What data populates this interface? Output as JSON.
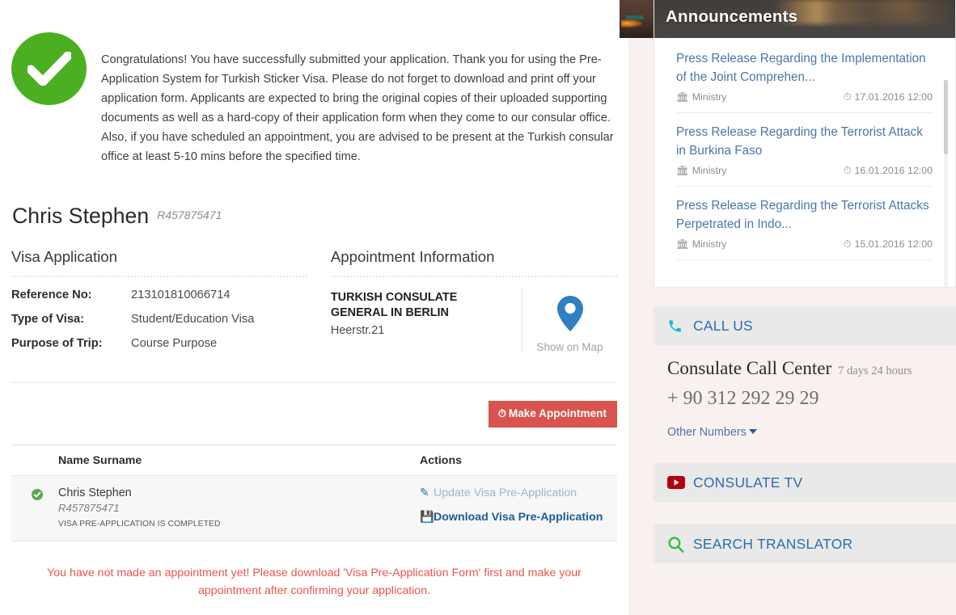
{
  "success": {
    "icon": "check-circle-icon",
    "message": "Congratulations! You have successfully submitted your application. Thank you for using the Pre-Application System for Turkish Sticker Visa. Please do not forget to download and print off your application form. Applicants are expected to bring the original copies of their uploaded supporting documents as well as a hard-copy of their application form when they come to our consular office. Also, if you have scheduled an appointment, you are advised to be present at the Turkish consular office at least 5-10 mins before the specified time."
  },
  "applicant": {
    "name": "Chris Stephen",
    "reference": "R457875471"
  },
  "visa_application": {
    "title": "Visa Application",
    "fields": [
      {
        "label": "Reference No:",
        "value": "213101810066714"
      },
      {
        "label": "Type of Visa:",
        "value": "Student/Education Visa"
      },
      {
        "label": "Purpose of Trip:",
        "value": "Course Purpose"
      }
    ]
  },
  "appointment": {
    "title": "Appointment Information",
    "office": "TURKISH CONSULATE GENERAL IN BERLIN",
    "address": "Heerstr.21",
    "map_label": "Show on Map",
    "map_icon": "map-pin-icon",
    "make_appointment_label": "Make Appointment",
    "make_appointment_icon": "clock-icon",
    "button_color": "#d9534f"
  },
  "table": {
    "columns": [
      "Name Surname",
      "Actions"
    ],
    "rows": [
      {
        "status_icon": "check-circle-small-icon",
        "name": "Chris Stephen",
        "reference": "R457875471",
        "status": "VISA PRE-APPLICATION IS COMPLETED",
        "actions": [
          {
            "label": "Update Visa Pre-Application",
            "icon": "pencil-icon",
            "emphasis": "normal"
          },
          {
            "label": "Download Visa Pre-Application",
            "icon": "floppy-disk-icon",
            "emphasis": "strong"
          }
        ]
      }
    ]
  },
  "warning": {
    "text": "You have not made an appointment yet! Please download 'Visa Pre-Application Form' first and make your appointment after confirming your application.",
    "color": "#ef5350"
  },
  "sidebar": {
    "announcements": {
      "title": "Announcements",
      "items": [
        {
          "title": "Press Release Regarding the Implementation of the Joint Comprehen...",
          "source": "Ministry",
          "source_icon": "institution-icon",
          "date": "17.01.2016 12:00",
          "date_icon": "clock-icon"
        },
        {
          "title": "Press Release Regarding the Terrorist Attack in Burkina Faso",
          "source": "Ministry",
          "source_icon": "institution-icon",
          "date": "16.01.2016 12:00",
          "date_icon": "clock-icon"
        },
        {
          "title": "Press Release Regarding the Terrorist Attacks Perpetrated in Indo...",
          "source": "Ministry",
          "source_icon": "institution-icon",
          "date": "15.01.2016 12:00",
          "date_icon": "clock-icon"
        }
      ]
    },
    "call_us": {
      "header": "CALL US",
      "header_icon": "phone-icon",
      "center_name": "Consulate Call Center",
      "hours": "7 days 24 hours",
      "phone": "+ 90 312 292 29 29",
      "other_numbers": "Other Numbers"
    },
    "consulate_tv": {
      "header": "CONSULATE TV",
      "header_icon": "youtube-icon"
    },
    "search_translator": {
      "header": "SEARCH TRANSLATOR",
      "header_icon": "search-icon"
    }
  }
}
